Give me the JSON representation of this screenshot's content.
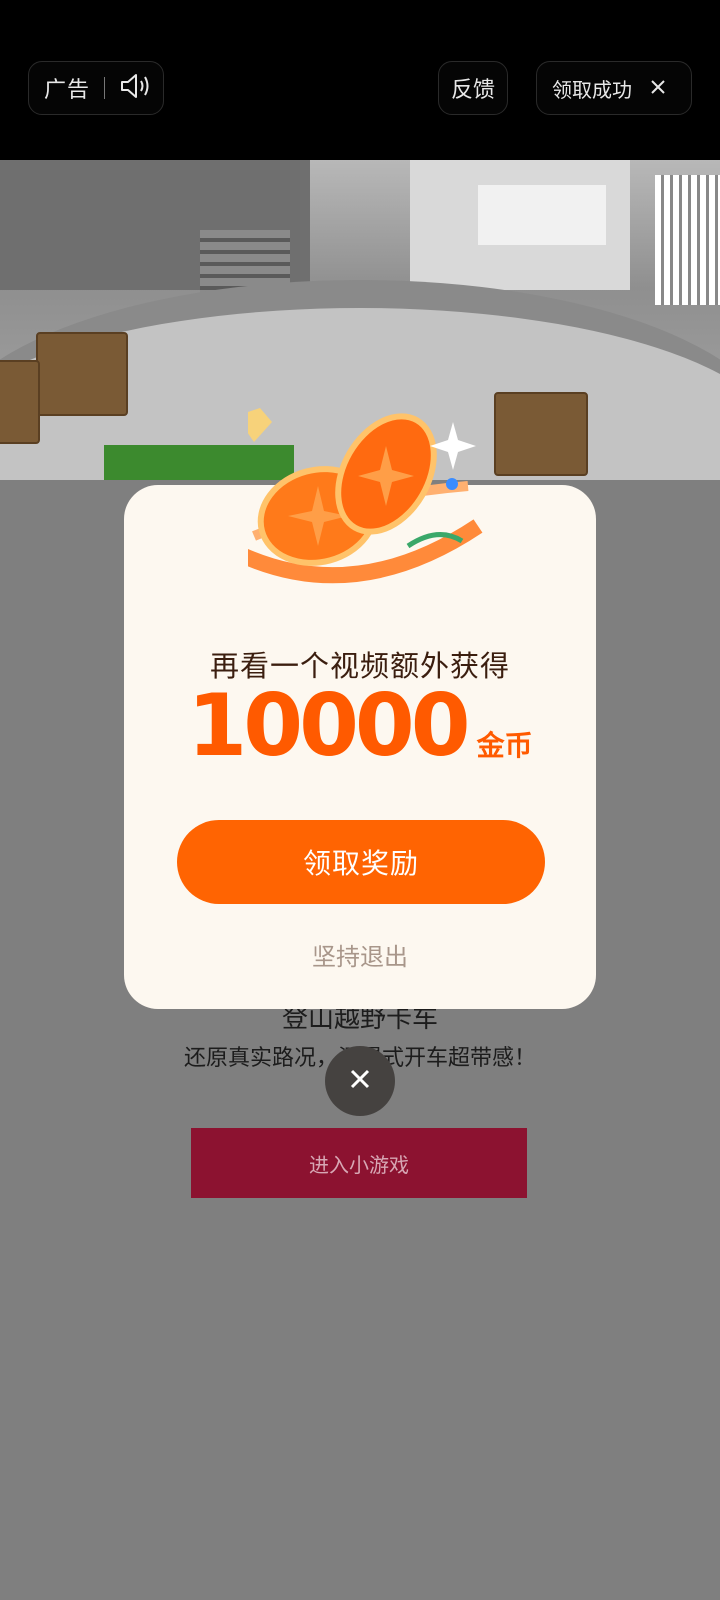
{
  "topbar": {
    "ad_label": "广告",
    "feedback_label": "反馈",
    "success_label": "领取成功"
  },
  "game": {
    "title": "登山越野卡车",
    "description": "还原真实路况，沉浸式开车超带感！",
    "enter_label": "进入小游戏"
  },
  "modal": {
    "subtitle": "再看一个视频额外获得",
    "amount": "10000",
    "unit": "金币",
    "claim_label": "领取奖励",
    "exit_label": "坚持退出"
  },
  "icons": {
    "speaker": "speaker-icon",
    "close": "close-icon",
    "coins": "coin-stack-icon"
  },
  "colors": {
    "accent": "#ff6402",
    "amount": "#ff5a00",
    "enter_button": "#8c1230"
  }
}
